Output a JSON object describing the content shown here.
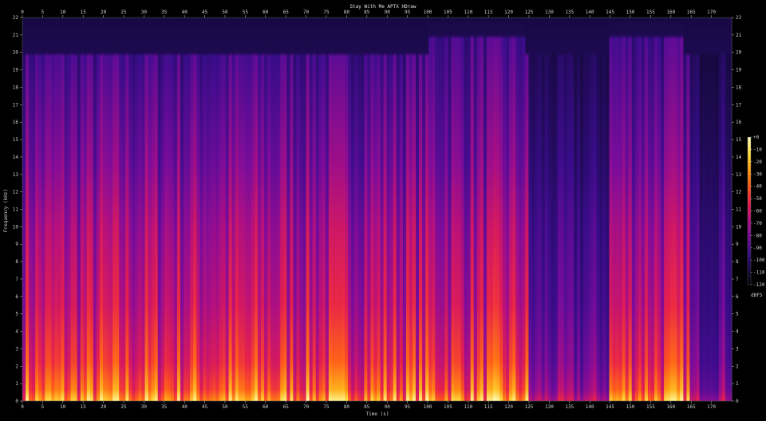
{
  "chart_data": {
    "type": "heatmap",
    "title": "Stay With Me APTX HDraw",
    "xlabel": "Time (s)",
    "ylabel": "Frequency (kHz)",
    "colorbar_label": "dBFS",
    "xlim": [
      0,
      175
    ],
    "ylim": [
      0,
      22
    ],
    "x_ticks": [
      "0",
      "5",
      "10",
      "15",
      "20",
      "25",
      "30",
      "35",
      "40",
      "45",
      "50",
      "55",
      "60",
      "65",
      "70",
      "75",
      "80",
      "85",
      "90",
      "95",
      "100",
      "105",
      "110",
      "115",
      "120",
      "125",
      "130",
      "135",
      "140",
      "145",
      "150",
      "155",
      "160",
      "165",
      "170"
    ],
    "y_ticks": [
      "0",
      "1",
      "2",
      "3",
      "4",
      "5",
      "6",
      "7",
      "8",
      "9",
      "10",
      "11",
      "12",
      "13",
      "14",
      "15",
      "16",
      "17",
      "18",
      "19",
      "20",
      "21",
      "22"
    ],
    "colorbar_ticks": [
      "+0",
      "-10",
      "-20",
      "-30",
      "-40",
      "-50",
      "-60",
      "-70",
      "-80",
      "-90",
      "-100",
      "-110",
      "-120"
    ],
    "colorbar_range": [
      -120,
      0
    ],
    "colormap": [
      "#000000",
      "#1a0a4a",
      "#3a0c8c",
      "#7a0c9c",
      "#b8107c",
      "#e8204c",
      "#ff5a1a",
      "#ffa010",
      "#ffe040",
      "#ffffc0"
    ],
    "grid": false,
    "bandwidth_regions_khz": [
      {
        "start": 0,
        "end": 100,
        "cutoff": 20
      },
      {
        "start": 100,
        "end": 124,
        "cutoff": 21
      },
      {
        "start": 124,
        "end": 145,
        "cutoff": 20
      },
      {
        "start": 145,
        "end": 163,
        "cutoff": 21
      },
      {
        "start": 163,
        "end": 175,
        "cutoff": 20
      }
    ],
    "quiet_segments_s": [
      [
        125,
        145
      ],
      [
        165,
        175
      ]
    ]
  }
}
